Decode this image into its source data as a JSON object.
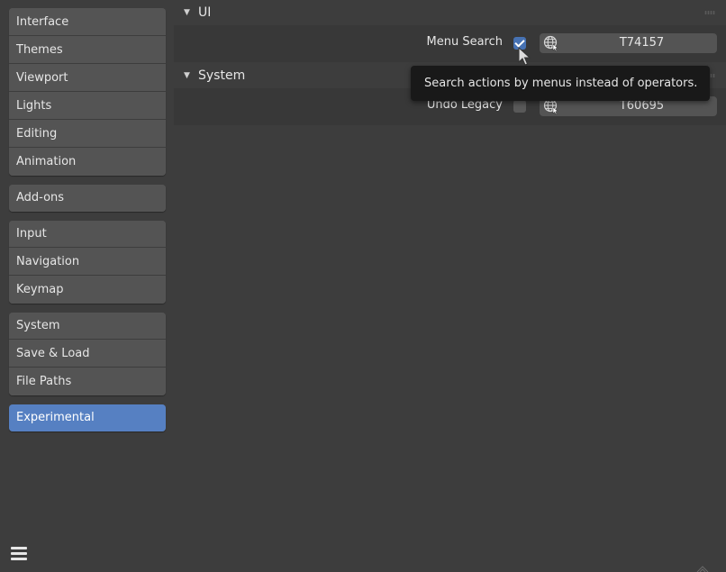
{
  "sidebar": {
    "groups": [
      {
        "items": [
          {
            "label": "Interface"
          },
          {
            "label": "Themes"
          },
          {
            "label": "Viewport"
          },
          {
            "label": "Lights"
          },
          {
            "label": "Editing"
          },
          {
            "label": "Animation"
          }
        ]
      },
      {
        "items": [
          {
            "label": "Add-ons"
          }
        ]
      },
      {
        "items": [
          {
            "label": "Input"
          },
          {
            "label": "Navigation"
          },
          {
            "label": "Keymap"
          }
        ]
      },
      {
        "items": [
          {
            "label": "System"
          },
          {
            "label": "Save & Load"
          },
          {
            "label": "File Paths"
          }
        ]
      },
      {
        "items": [
          {
            "label": "Experimental"
          }
        ]
      }
    ],
    "active_item": "Experimental",
    "menu_icon": "hamburger-menu-icon"
  },
  "panels": [
    {
      "title": "UI",
      "expanded": true,
      "row": {
        "label": "Menu Search",
        "checked": true,
        "link_label": "T74157",
        "link_icon": "globe-icon"
      }
    },
    {
      "title": "System",
      "expanded": true,
      "row": {
        "label": "Undo Legacy",
        "checked": false,
        "link_label": "T60695",
        "link_icon": "globe-icon"
      }
    }
  ],
  "tooltip": {
    "text": "Search actions by menus instead of operators."
  },
  "colors": {
    "accent": "#5680c2",
    "checkbox_checked": "#4772b3",
    "background": "#3d3d3d",
    "button": "#545454",
    "tooltip_bg": "#191919"
  }
}
